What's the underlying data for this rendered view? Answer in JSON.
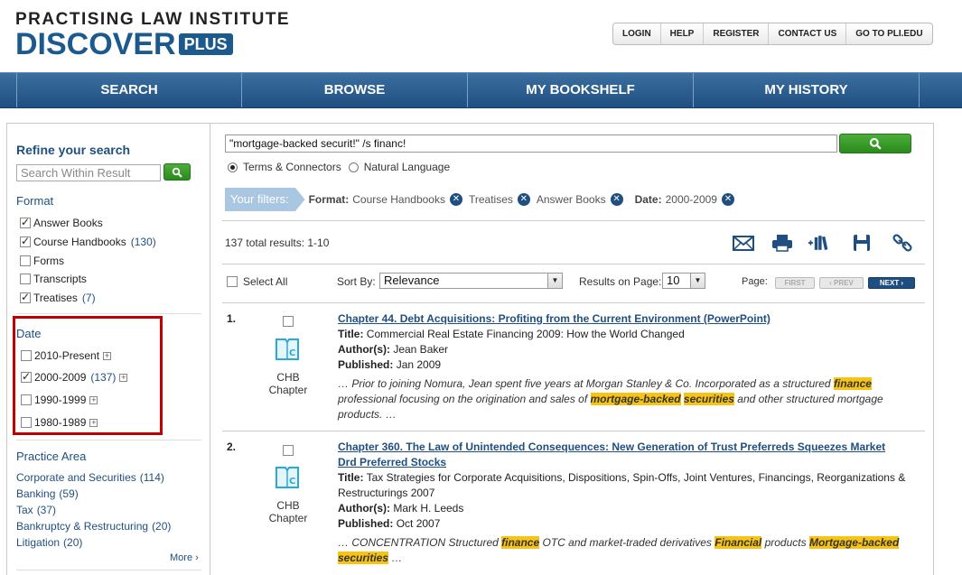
{
  "header": {
    "logo_top": "PRACTISING LAW INSTITUTE",
    "logo_main": "DISCOVER",
    "logo_plus": "PLUS",
    "links": [
      "LOGIN",
      "HELP",
      "REGISTER",
      "CONTACT US",
      "GO TO PLI.EDU"
    ]
  },
  "nav": [
    "SEARCH",
    "BROWSE",
    "MY BOOKSHELF",
    "MY HISTORY"
  ],
  "sidebar": {
    "refine_title": "Refine your search",
    "search_within_placeholder": "Search Within Result",
    "format_title": "Format",
    "format": [
      {
        "label": "Answer Books",
        "count": "",
        "checked": true
      },
      {
        "label": "Course Handbooks",
        "count": "(130)",
        "checked": true
      },
      {
        "label": "Forms",
        "count": "",
        "checked": false
      },
      {
        "label": "Transcripts",
        "count": "",
        "checked": false
      },
      {
        "label": "Treatises",
        "count": "(7)",
        "checked": true
      }
    ],
    "date_title": "Date",
    "date": [
      {
        "label": "2010-Present",
        "count": "",
        "checked": false
      },
      {
        "label": "2000-2009",
        "count": "(137)",
        "checked": true
      },
      {
        "label": "1990-1999",
        "count": "",
        "checked": false
      },
      {
        "label": "1980-1989",
        "count": "",
        "checked": false
      }
    ],
    "practice_title": "Practice Area",
    "practice": [
      {
        "label": "Corporate and Securities",
        "count": "(114)"
      },
      {
        "label": "Banking",
        "count": "(59)"
      },
      {
        "label": "Tax",
        "count": "(37)"
      },
      {
        "label": "Bankruptcy & Restructuring",
        "count": "(20)"
      },
      {
        "label": "Litigation",
        "count": "(20)"
      }
    ],
    "more": "More ›"
  },
  "search": {
    "query": "\"mortgage-backed securit!\" /s financ!",
    "mode_terms": "Terms & Connectors",
    "mode_natural": "Natural Language"
  },
  "filters": {
    "label": "Your filters:",
    "format_key": "Format:",
    "items": [
      "Course Handbooks",
      "Treatises",
      "Answer Books"
    ],
    "date_key": "Date:",
    "date_value": "2000-2009"
  },
  "results_bar": {
    "total": "137 total results: 1-10",
    "select_all": "Select All",
    "sort_label": "Sort By:",
    "sort_value": "Relevance",
    "per_page_label": "Results on Page:",
    "per_page_value": "10",
    "page_label": "Page:",
    "first": "FIRST",
    "prev": "‹ PREV",
    "next": "NEXT ›"
  },
  "results": [
    {
      "num": "1.",
      "type": "CHB Chapter",
      "title": "Chapter 44. Debt Acquisitions: Profiting from the Current Environment (PowerPoint)",
      "title_label": "Title:",
      "title_value": "Commercial Real Estate Financing 2009: How the World Changed",
      "author_label": "Author(s):",
      "author_value": "Jean Baker",
      "published_label": "Published:",
      "published_value": "Jan 2009",
      "snip1": "… Prior to joining Nomura, Jean spent five years at Morgan Stanley & Co. Incorporated as a structured ",
      "hl1": "finance",
      "snip2": " professional focusing on the origination and sales of ",
      "hl2": "mortgage-backed",
      "hl3": "securities",
      "snip3": " and other structured mortgage products. …"
    },
    {
      "num": "2.",
      "type": "CHB Chapter",
      "title": "Chapter 360. The Law of Unintended Consequences: New Generation of Trust Preferreds Squeezes Market Drd Preferred Stocks",
      "title_label": "Title:",
      "title_value": "Tax Strategies for Corporate Acquisitions, Dispositions, Spin-Offs, Joint Ventures, Financings, Reorganizations & Restructurings 2007",
      "author_label": "Author(s):",
      "author_value": "Mark H. Leeds",
      "published_label": "Published:",
      "published_value": "Oct 2007",
      "snip1": "… CONCENTRATION Structured ",
      "hl1": "finance",
      "snip2": " OTC and market-traded derivatives ",
      "hl2": "Financial",
      "snip3": " products ",
      "hl3": "Mortgage-backed",
      "hl4": "securities",
      "snip4": " …"
    }
  ],
  "colors": {
    "brand": "#1f4f80",
    "highlight": "#f7c415",
    "go": "#2a8a1d",
    "alert": "#c00000"
  }
}
